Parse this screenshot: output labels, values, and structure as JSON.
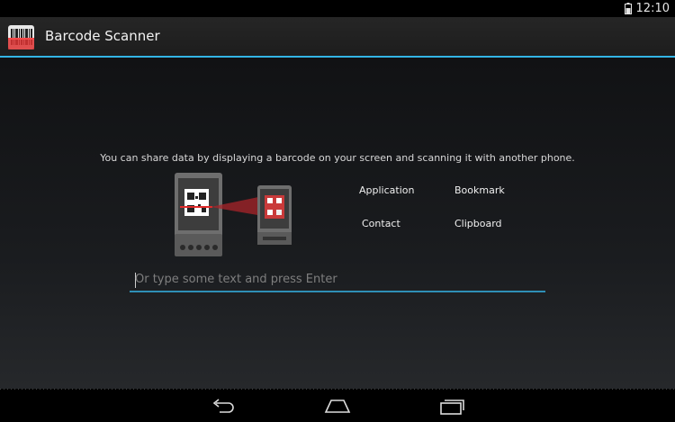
{
  "status": {
    "time": "12:10"
  },
  "app": {
    "title": "Barcode Scanner"
  },
  "share": {
    "description": "You can share data by displaying a barcode on your screen and scanning it with another phone.",
    "buttons": {
      "application": "Application",
      "bookmark": "Bookmark",
      "contact": "Contact",
      "clipboard": "Clipboard"
    },
    "input_placeholder": "Or type some text and press Enter"
  },
  "colors": {
    "accent": "#33b5e5",
    "laser": "#c0282b"
  },
  "nav": {
    "back_icon": "back-icon",
    "home_icon": "home-icon",
    "recents_icon": "recent-apps-icon"
  }
}
